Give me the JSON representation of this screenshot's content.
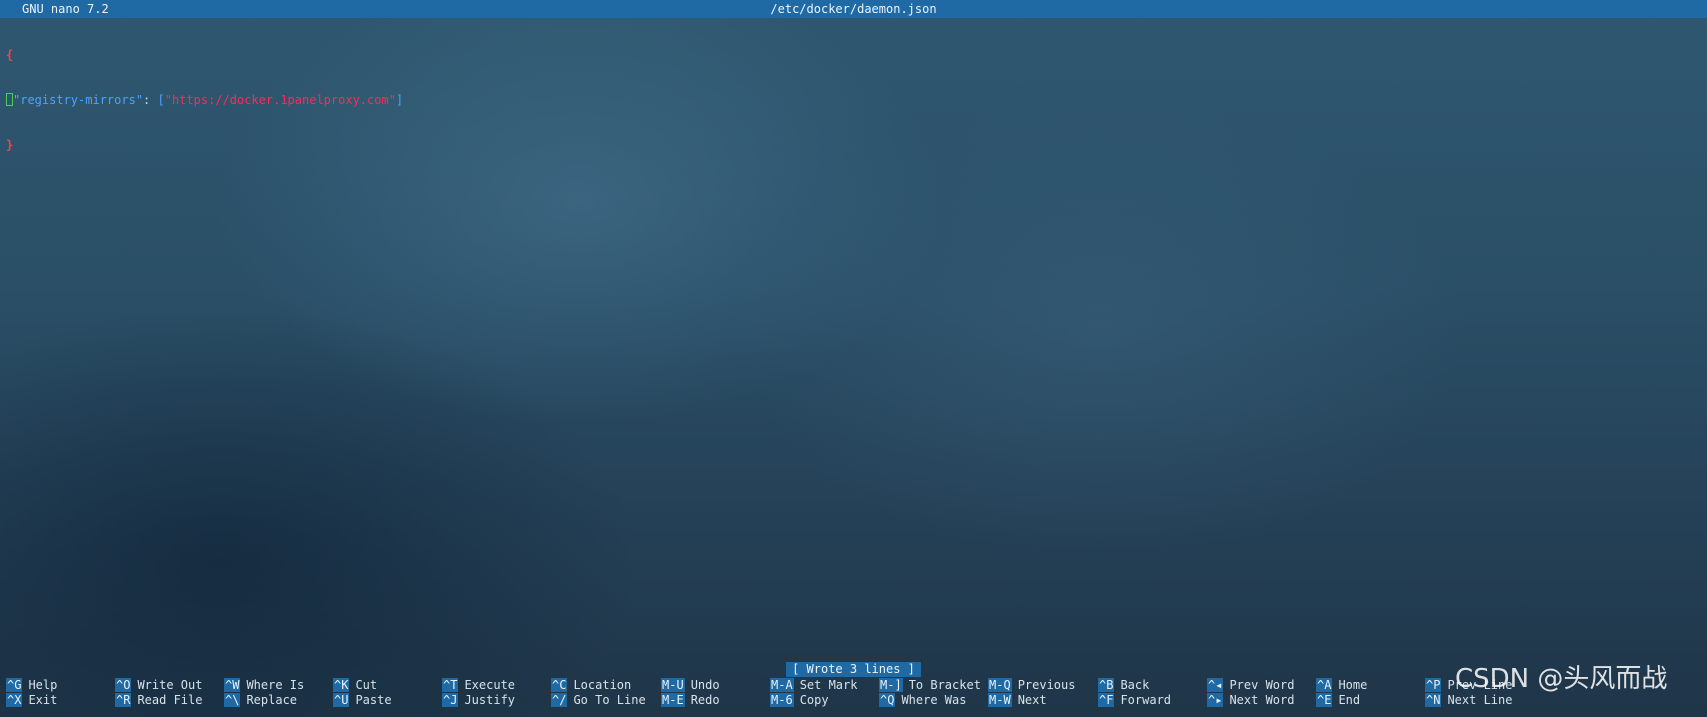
{
  "title_bar": {
    "app": "GNU nano 7.2",
    "file": "/etc/docker/daemon.json"
  },
  "editor": {
    "line1": "{",
    "line2_key": "\"registry-mirrors\"",
    "line2_colon": ": ",
    "line2_open": "[",
    "line2_value": "\"https://docker.1panelproxy.com\"",
    "line2_close": "]",
    "line3": "}"
  },
  "status_message": "[ Wrote 3 lines ]",
  "shortcuts": {
    "row1": [
      {
        "key": "^G",
        "label": "Help"
      },
      {
        "key": "^O",
        "label": "Write Out"
      },
      {
        "key": "^W",
        "label": "Where Is"
      },
      {
        "key": "^K",
        "label": "Cut"
      },
      {
        "key": "^T",
        "label": "Execute"
      },
      {
        "key": "^C",
        "label": "Location"
      },
      {
        "key": "M-U",
        "label": "Undo"
      },
      {
        "key": "M-A",
        "label": "Set Mark"
      },
      {
        "key": "M-]",
        "label": "To Bracket"
      },
      {
        "key": "M-Q",
        "label": "Previous"
      },
      {
        "key": "^B",
        "label": "Back"
      },
      {
        "key": "^◂",
        "label": "Prev Word"
      },
      {
        "key": "^A",
        "label": "Home"
      },
      {
        "key": "^P",
        "label": "Prev Line"
      }
    ],
    "row2": [
      {
        "key": "^X",
        "label": "Exit"
      },
      {
        "key": "^R",
        "label": "Read File"
      },
      {
        "key": "^\\",
        "label": "Replace"
      },
      {
        "key": "^U",
        "label": "Paste"
      },
      {
        "key": "^J",
        "label": "Justify"
      },
      {
        "key": "^/",
        "label": "Go To Line"
      },
      {
        "key": "M-E",
        "label": "Redo"
      },
      {
        "key": "M-6",
        "label": "Copy"
      },
      {
        "key": "^Q",
        "label": "Where Was"
      },
      {
        "key": "M-W",
        "label": "Next"
      },
      {
        "key": "^F",
        "label": "Forward"
      },
      {
        "key": "^▸",
        "label": "Next Word"
      },
      {
        "key": "^E",
        "label": "End"
      },
      {
        "key": "^N",
        "label": "Next Line"
      }
    ]
  },
  "watermark": "CSDN @头风而战"
}
